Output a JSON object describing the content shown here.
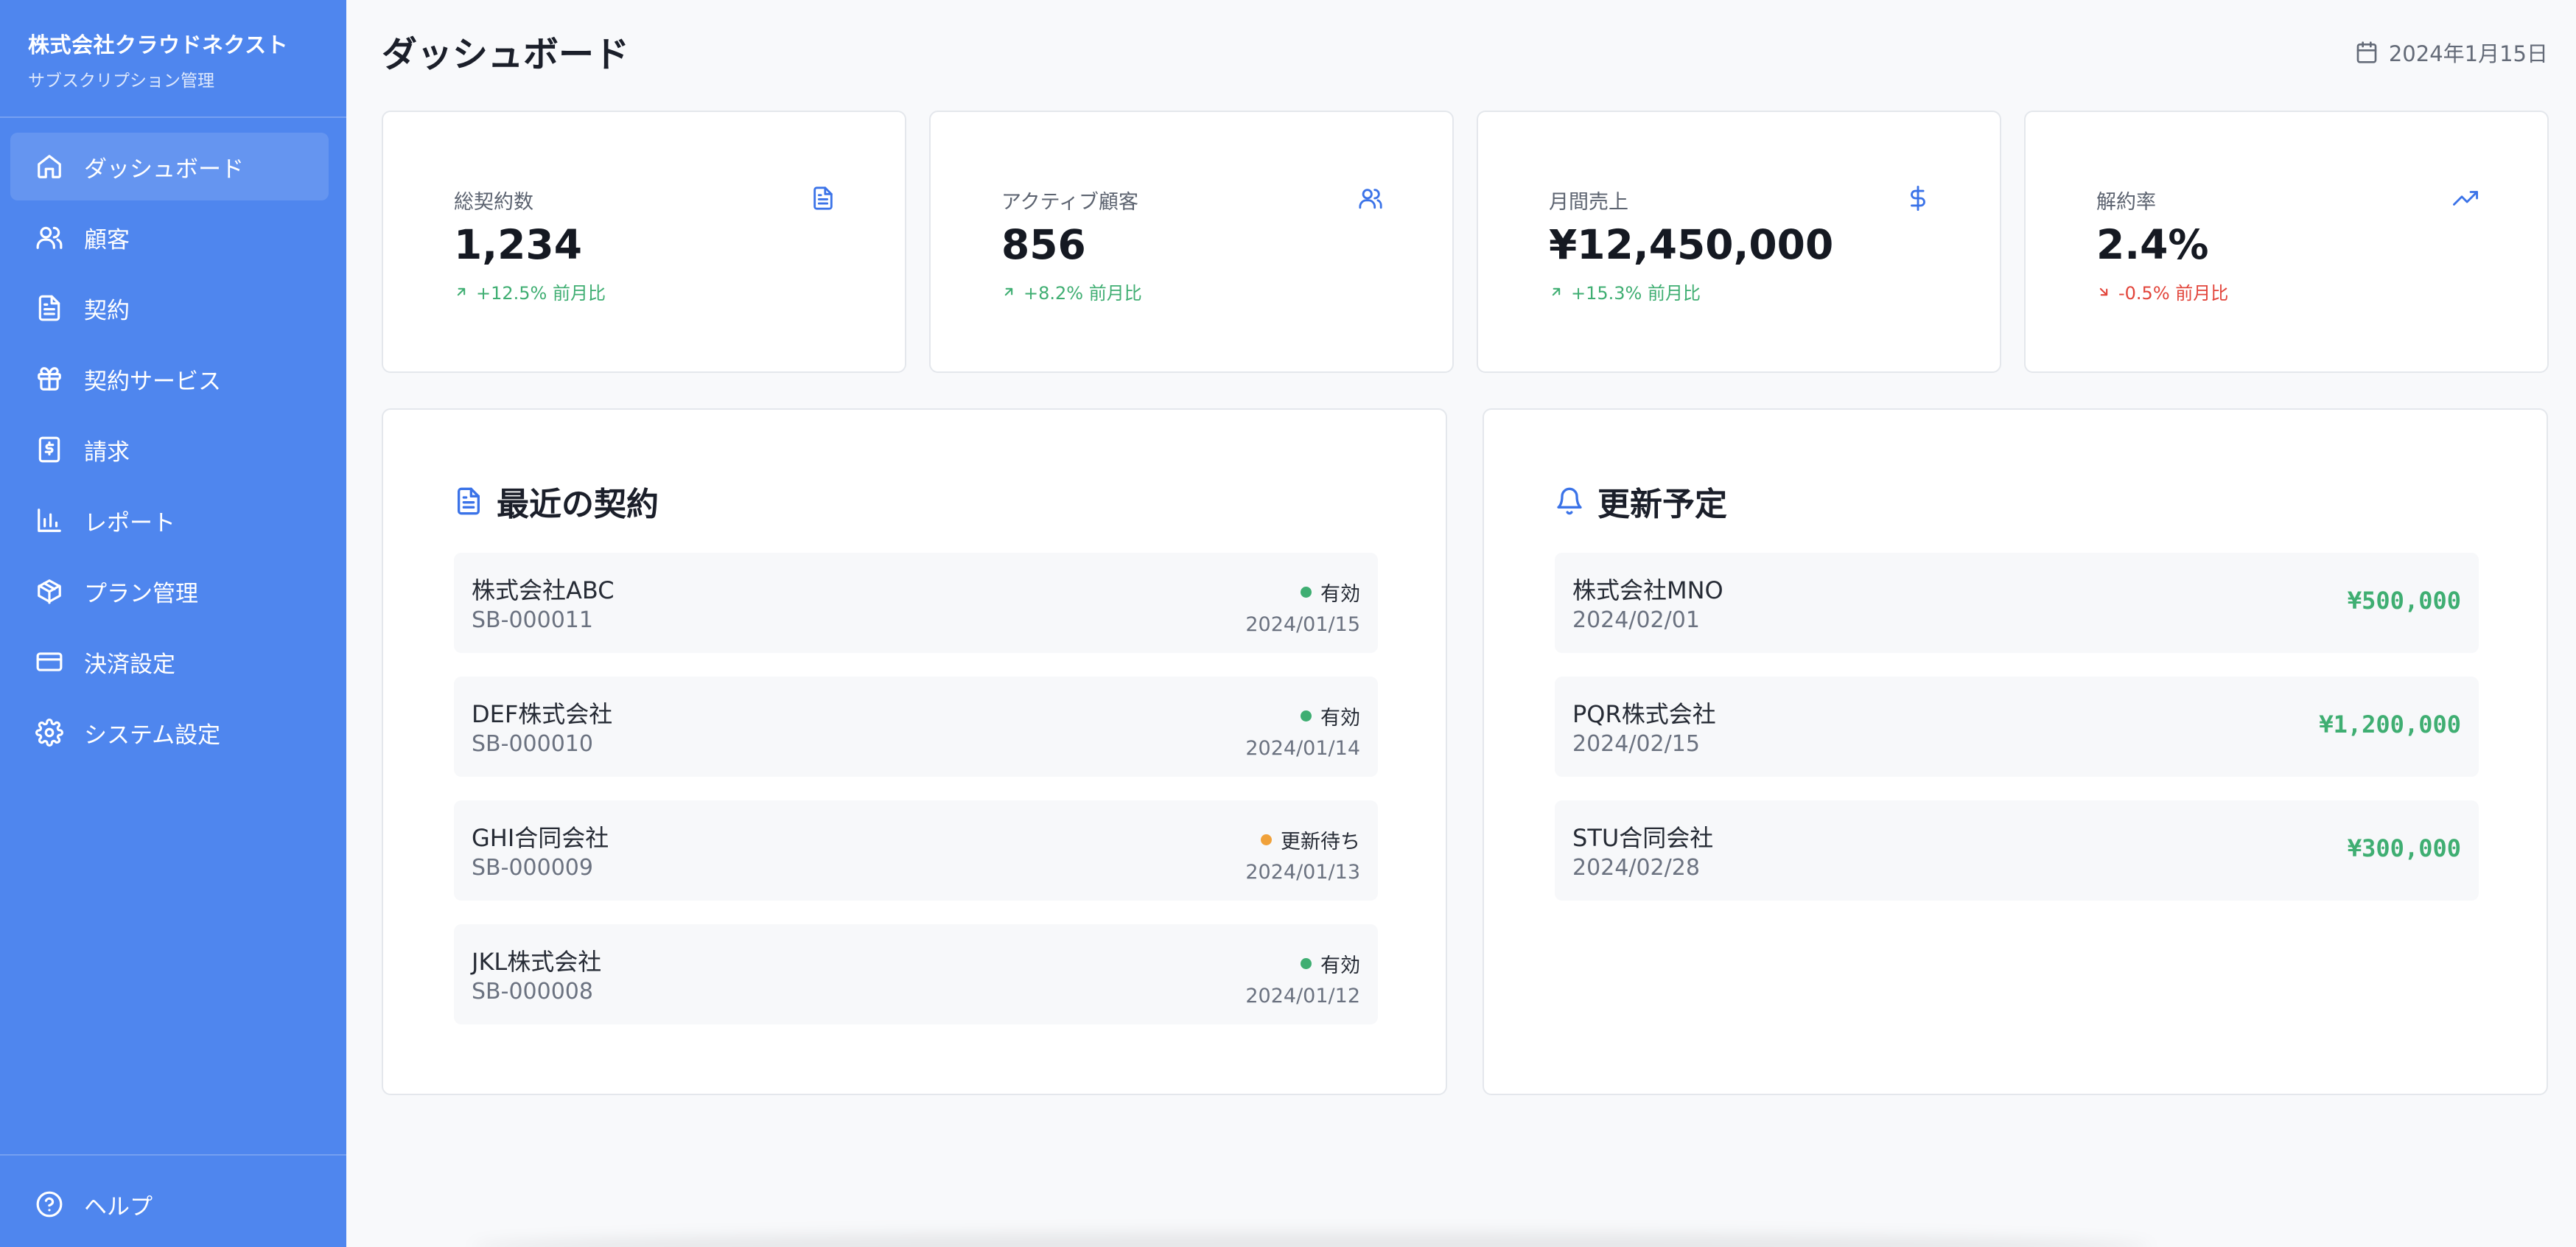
{
  "sidebar": {
    "company": "株式会社クラウドネクスト",
    "subtitle": "サブスクリプション管理",
    "items": [
      {
        "label": "ダッシュボード",
        "icon": "home-icon",
        "active": true
      },
      {
        "label": "顧客",
        "icon": "users-icon"
      },
      {
        "label": "契約",
        "icon": "document-icon"
      },
      {
        "label": "契約サービス",
        "icon": "gift-icon"
      },
      {
        "label": "請求",
        "icon": "invoice-icon"
      },
      {
        "label": "レポート",
        "icon": "bar-chart-icon"
      },
      {
        "label": "プラン管理",
        "icon": "box-icon"
      },
      {
        "label": "決済設定",
        "icon": "credit-card-icon"
      },
      {
        "label": "システム設定",
        "icon": "gear-icon"
      }
    ],
    "help": {
      "label": "ヘルプ",
      "icon": "help-circle-icon"
    }
  },
  "header": {
    "title": "ダッシュボード",
    "date": "2024年1月15日",
    "date_icon": "calendar-icon"
  },
  "stats": [
    {
      "label": "総契約数",
      "value": "1,234",
      "change": "+12.5% 前月比",
      "trend": "up",
      "icon": "document-icon"
    },
    {
      "label": "アクティブ顧客",
      "value": "856",
      "change": "+8.2% 前月比",
      "trend": "up",
      "icon": "users-icon"
    },
    {
      "label": "月間売上",
      "value": "¥12,450,000",
      "change": "+15.3% 前月比",
      "trend": "up",
      "icon": "dollar-icon"
    },
    {
      "label": "解約率",
      "value": "2.4%",
      "change": "-0.5% 前月比",
      "trend": "down",
      "icon": "trending-up-icon"
    }
  ],
  "recent_contracts": {
    "title": "最近の契約",
    "icon": "document-icon",
    "rows": [
      {
        "company": "株式会社ABC",
        "id": "SB-000011",
        "status": "有効",
        "status_color": "#3fae72",
        "date": "2024/01/15"
      },
      {
        "company": "DEF株式会社",
        "id": "SB-000010",
        "status": "有効",
        "status_color": "#3fae72",
        "date": "2024/01/14"
      },
      {
        "company": "GHI合同会社",
        "id": "SB-000009",
        "status": "更新待ち",
        "status_color": "#f0a13a",
        "date": "2024/01/13"
      },
      {
        "company": "JKL株式会社",
        "id": "SB-000008",
        "status": "有効",
        "status_color": "#3fae72",
        "date": "2024/01/12"
      }
    ]
  },
  "renewals": {
    "title": "更新予定",
    "icon": "bell-icon",
    "rows": [
      {
        "company": "株式会社MNO",
        "date": "2024/02/01",
        "amount": "¥500,000"
      },
      {
        "company": "PQR株式会社",
        "date": "2024/02/15",
        "amount": "¥1,200,000"
      },
      {
        "company": "STU合同会社",
        "date": "2024/02/28",
        "amount": "¥300,000"
      }
    ]
  },
  "colors": {
    "sidebar": "#4f86ee",
    "accent": "#3b73e8",
    "positive": "#3fae72",
    "negative": "#e2443a",
    "pending": "#f0a13a"
  }
}
